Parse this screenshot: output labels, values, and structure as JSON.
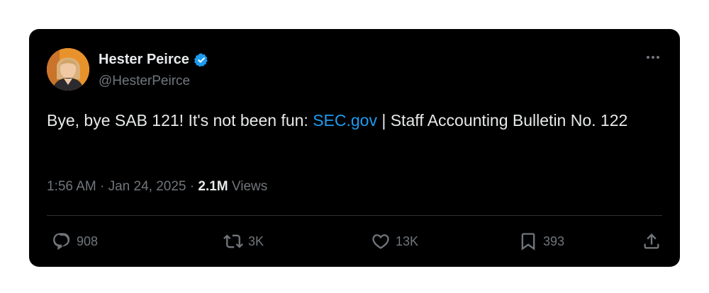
{
  "author": {
    "display_name": "Hester Peirce",
    "handle": "@HesterPeirce"
  },
  "tweet": {
    "text_before": "Bye, bye SAB 121! It's not been fun: ",
    "link_text": "SEC.gov",
    "text_after": " | Staff Accounting Bulletin No. 122"
  },
  "meta": {
    "time": "1:56 AM",
    "sep1": " · ",
    "date": "Jan 24, 2025",
    "sep2": " · ",
    "views_count": "2.1M",
    "views_label": " Views"
  },
  "actions": {
    "replies": "908",
    "reposts": "3K",
    "likes": "13K",
    "bookmarks": "393"
  },
  "colors": {
    "background": "#000000",
    "text": "#e7e9ea",
    "muted": "#71767b",
    "link": "#1d9bf0",
    "verified": "#1d9bf0"
  },
  "icons": [
    "verified-badge-icon",
    "more-options-icon",
    "reply-icon",
    "repost-icon",
    "like-icon",
    "bookmark-icon",
    "share-icon"
  ]
}
